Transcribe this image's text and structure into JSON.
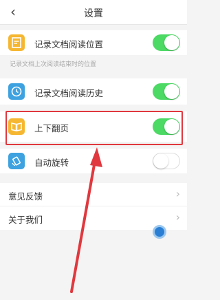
{
  "header": {
    "title": "设置",
    "back_icon": "chevron-left-icon"
  },
  "settings": [
    {
      "label": "记录文档阅读位置",
      "icon": "document-bookmark-icon",
      "icon_color": "#f5b731",
      "on": true
    },
    {
      "label": "记录文档阅读历史",
      "icon": "clock-icon",
      "icon_color": "#3ea2e0",
      "on": true
    },
    {
      "label": "上下翻页",
      "icon": "book-icon",
      "icon_color": "#f5b731",
      "on": true
    },
    {
      "label": "自动旋转",
      "icon": "rotate-icon",
      "icon_color": "#3ea2e0",
      "on": false
    }
  ],
  "hint": "记录文档上次阅读结束时的位置",
  "nav": [
    {
      "label": "意见反馈"
    },
    {
      "label": "关于我们"
    }
  ],
  "colors": {
    "toggle_on": "#4cd964",
    "highlight": "#e0383e",
    "arrow": "#e0383e"
  }
}
